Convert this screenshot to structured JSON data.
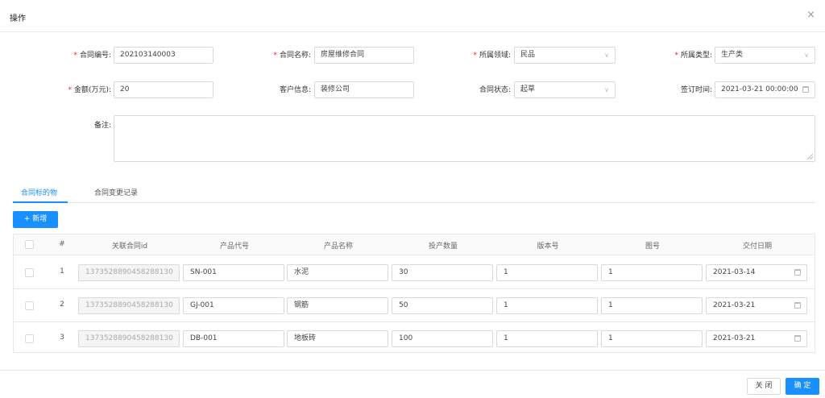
{
  "dialog": {
    "title": "操作",
    "close_icon": "×"
  },
  "form": {
    "contract_no": {
      "label": "合同编号:",
      "value": "202103140003"
    },
    "contract_name": {
      "label": "合同名称:",
      "value": "房屋维修合同"
    },
    "domain": {
      "label": "所属领域:",
      "value": "民品"
    },
    "type": {
      "label": "所属类型:",
      "value": "生产类"
    },
    "amount": {
      "label": "金额(万元):",
      "value": "20"
    },
    "customer": {
      "label": "客户信息:",
      "value": "装修公司"
    },
    "status": {
      "label": "合同状态:",
      "value": "起草"
    },
    "sign_time": {
      "label": "签订时间:",
      "value": "2021-03-21 00:00:00"
    },
    "remark": {
      "label": "备注:",
      "value": ""
    },
    "required_mark": "*",
    "select_arrow": "∨"
  },
  "tabs": [
    {
      "label": "合同标的物"
    },
    {
      "label": "合同变更记录"
    }
  ],
  "add_button": {
    "label": "+ 新增"
  },
  "table": {
    "headers": [
      "#",
      "关联合同id",
      "产品代号",
      "产品名称",
      "投产数量",
      "版本号",
      "图号",
      "交付日期"
    ],
    "rows": [
      {
        "index": "1",
        "contract_id": "1373528890458288130",
        "code": "SN-001",
        "name": "水泥",
        "qty": "30",
        "version": "1",
        "drawing": "1",
        "date": "2021-03-14"
      },
      {
        "index": "2",
        "contract_id": "1373528890458288130",
        "code": "GJ-001",
        "name": "钢筋",
        "qty": "50",
        "version": "1",
        "drawing": "1",
        "date": "2021-03-21"
      },
      {
        "index": "3",
        "contract_id": "1373528890458288130",
        "code": "DB-001",
        "name": "地板砖",
        "qty": "100",
        "version": "1",
        "drawing": "1",
        "date": "2021-03-21"
      }
    ]
  },
  "footer": {
    "close_label": "关 闭",
    "ok_label": "确 定"
  },
  "colors": {
    "primary": "#1890ff",
    "required": "#f5222d"
  }
}
